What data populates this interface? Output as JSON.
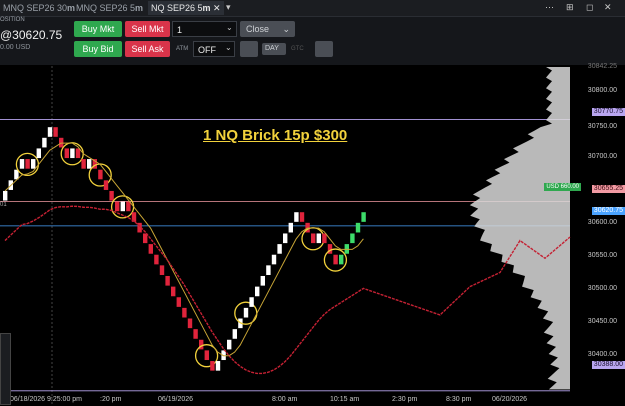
{
  "tabs": [
    {
      "label": "MNQ SEP26 30",
      "unit": "m"
    },
    {
      "label": "MNQ SEP26 5",
      "unit": "m"
    },
    {
      "label": "NQ SEP26 5",
      "unit": "m"
    }
  ],
  "account_label": "OSITION",
  "last_price": "@30620.75",
  "usd_value": "0.00 USD",
  "buttons": {
    "buy_mkt": "Buy Mkt",
    "sell_mkt": "Sell Mkt",
    "buy_bid": "Buy Bid",
    "sell_ask": "Sell Ask",
    "close": "Close",
    "atm": "ATM",
    "atm_value": "OFF",
    "day": "DAY",
    "gtc": "GTC"
  },
  "quantity": "1",
  "chart_title": "1 NQ Brick 15p $300",
  "left_marker": "01",
  "y_axis": {
    "ticks": [
      "30800.00",
      "30750.00",
      "30700.00",
      "30650.00",
      "30600.00",
      "30550.00",
      "30500.00",
      "30450.00",
      "30400.00"
    ],
    "top_clip": "30842.25",
    "badges": [
      {
        "text": "30770.75",
        "color": "#b9a6f0"
      },
      {
        "text": "USD 660.00",
        "color": "#2fa84f"
      },
      {
        "text": "30655.25",
        "color": "#f29aa3"
      },
      {
        "text": "30620.75",
        "color": "#4aa3ff"
      },
      {
        "text": "30388.00",
        "color": "#b9a6f0"
      }
    ]
  },
  "x_axis": {
    "labels": [
      "06/18/2026 9:25:00 pm",
      ":20 pm",
      "06/19/2026",
      "8:00 am",
      "10:15 am",
      "2:30 pm",
      "8:30 pm",
      "06/20/2026"
    ]
  },
  "chart_data": {
    "type": "renko",
    "brick_size": 15,
    "bricks": [
      {
        "dir": "up",
        "price": 30670
      },
      {
        "dir": "up",
        "price": 30685
      },
      {
        "dir": "up",
        "price": 30700
      },
      {
        "dir": "up",
        "price": 30715
      },
      {
        "dir": "down",
        "price": 30700
      },
      {
        "dir": "up",
        "price": 30715
      },
      {
        "dir": "up",
        "price": 30730
      },
      {
        "dir": "up",
        "price": 30745
      },
      {
        "dir": "up",
        "price": 30760
      },
      {
        "dir": "down",
        "price": 30745
      },
      {
        "dir": "down",
        "price": 30730
      },
      {
        "dir": "down",
        "price": 30715
      },
      {
        "dir": "up",
        "price": 30730
      },
      {
        "dir": "down",
        "price": 30715
      },
      {
        "dir": "down",
        "price": 30700
      },
      {
        "dir": "up",
        "price": 30715
      },
      {
        "dir": "down",
        "price": 30700
      },
      {
        "dir": "down",
        "price": 30685
      },
      {
        "dir": "down",
        "price": 30670
      },
      {
        "dir": "down",
        "price": 30655
      },
      {
        "dir": "down",
        "price": 30640
      },
      {
        "dir": "up",
        "price": 30655
      },
      {
        "dir": "down",
        "price": 30640
      },
      {
        "dir": "down",
        "price": 30625
      },
      {
        "dir": "down",
        "price": 30610
      },
      {
        "dir": "down",
        "price": 30595
      },
      {
        "dir": "down",
        "price": 30580
      },
      {
        "dir": "down",
        "price": 30565
      },
      {
        "dir": "down",
        "price": 30550
      },
      {
        "dir": "down",
        "price": 30535
      },
      {
        "dir": "down",
        "price": 30520
      },
      {
        "dir": "down",
        "price": 30505
      },
      {
        "dir": "down",
        "price": 30490
      },
      {
        "dir": "down",
        "price": 30475
      },
      {
        "dir": "down",
        "price": 30460
      },
      {
        "dir": "down",
        "price": 30445
      },
      {
        "dir": "down",
        "price": 30430
      },
      {
        "dir": "down",
        "price": 30415
      },
      {
        "dir": "up",
        "price": 30430
      },
      {
        "dir": "up",
        "price": 30445
      },
      {
        "dir": "up",
        "price": 30460
      },
      {
        "dir": "up",
        "price": 30475
      },
      {
        "dir": "up",
        "price": 30490
      },
      {
        "dir": "up",
        "price": 30505
      },
      {
        "dir": "up",
        "price": 30520
      },
      {
        "dir": "up",
        "price": 30535
      },
      {
        "dir": "up",
        "price": 30550
      },
      {
        "dir": "up",
        "price": 30565
      },
      {
        "dir": "up",
        "price": 30580
      },
      {
        "dir": "up",
        "price": 30595
      },
      {
        "dir": "up",
        "price": 30610
      },
      {
        "dir": "up",
        "price": 30625
      },
      {
        "dir": "up",
        "price": 30640
      },
      {
        "dir": "down",
        "price": 30625
      },
      {
        "dir": "down",
        "price": 30610
      },
      {
        "dir": "down",
        "price": 30595
      },
      {
        "dir": "up",
        "price": 30610
      },
      {
        "dir": "down",
        "price": 30595
      },
      {
        "dir": "down",
        "price": 30580
      },
      {
        "dir": "down",
        "price": 30565
      },
      {
        "dir": "up",
        "price": 30580
      },
      {
        "dir": "up",
        "price": 30595
      },
      {
        "dir": "up",
        "price": 30610
      },
      {
        "dir": "up",
        "price": 30625
      },
      {
        "dir": "up",
        "price": 30640
      }
    ],
    "highlight_bricks": [
      4,
      12,
      17,
      21,
      36,
      43,
      55,
      59
    ],
    "current_price": 30620.75,
    "level_lines": [
      30770.75,
      30655.25,
      30388.0
    ],
    "ylim": [
      30375,
      30850
    ]
  }
}
